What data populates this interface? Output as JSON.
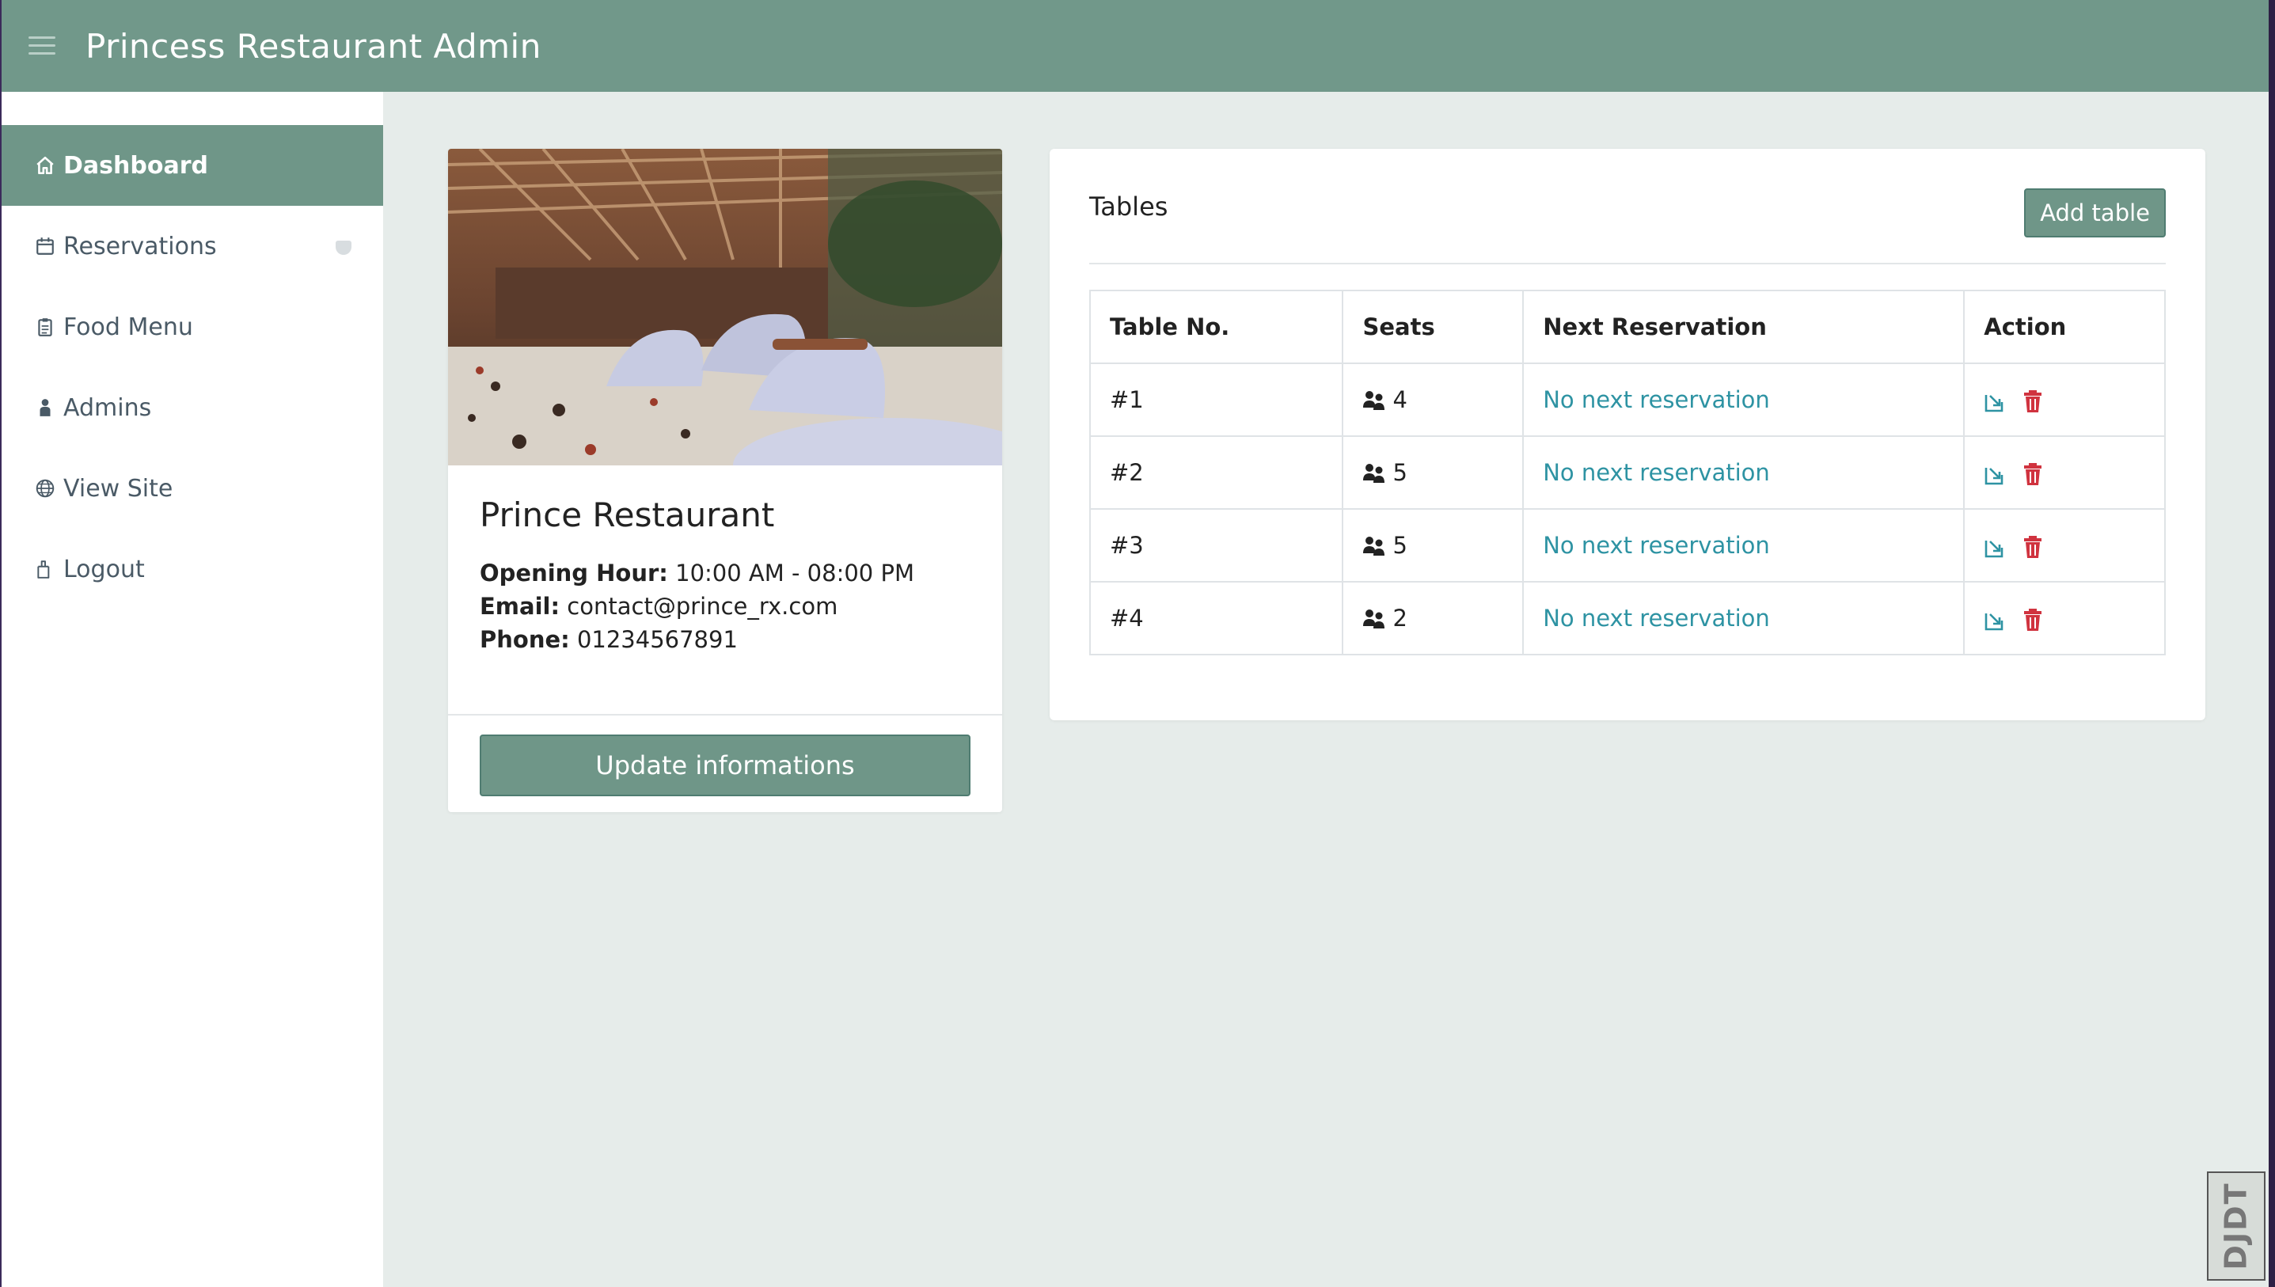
{
  "header": {
    "title": "Princess Restaurant Admin"
  },
  "sidebar": {
    "items": [
      {
        "label": "Dashboard",
        "icon": "home-icon",
        "active": true
      },
      {
        "label": "Reservations",
        "icon": "calendar-icon",
        "active": false
      },
      {
        "label": "Food Menu",
        "icon": "clipboard-icon",
        "active": false
      },
      {
        "label": "Admins",
        "icon": "person-icon",
        "active": false
      },
      {
        "label": "View Site",
        "icon": "globe-icon",
        "active": false
      },
      {
        "label": "Logout",
        "icon": "logout-icon",
        "active": false
      }
    ]
  },
  "restaurant": {
    "name": "Prince Restaurant",
    "opening_label": "Opening Hour:",
    "opening_value": "10:00 AM - 08:00 PM",
    "email_label": "Email:",
    "email_value": "contact@prince_rx.com",
    "phone_label": "Phone:",
    "phone_value": "01234567891",
    "update_button": "Update informations"
  },
  "tables": {
    "title": "Tables",
    "add_button": "Add table",
    "headers": [
      "Table No.",
      "Seats",
      "Next Reservation",
      "Action"
    ],
    "rows": [
      {
        "table_no": "#1",
        "seats": "4",
        "next": "No next reservation"
      },
      {
        "table_no": "#2",
        "seats": "5",
        "next": "No next reservation"
      },
      {
        "table_no": "#3",
        "seats": "5",
        "next": "No next reservation"
      },
      {
        "table_no": "#4",
        "seats": "2",
        "next": "No next reservation"
      }
    ]
  },
  "watermark": "DJDT",
  "colors": {
    "topbar": "#71988a",
    "accent": "#6f9688",
    "link": "#2e93a3",
    "delete": "#d0333f"
  }
}
